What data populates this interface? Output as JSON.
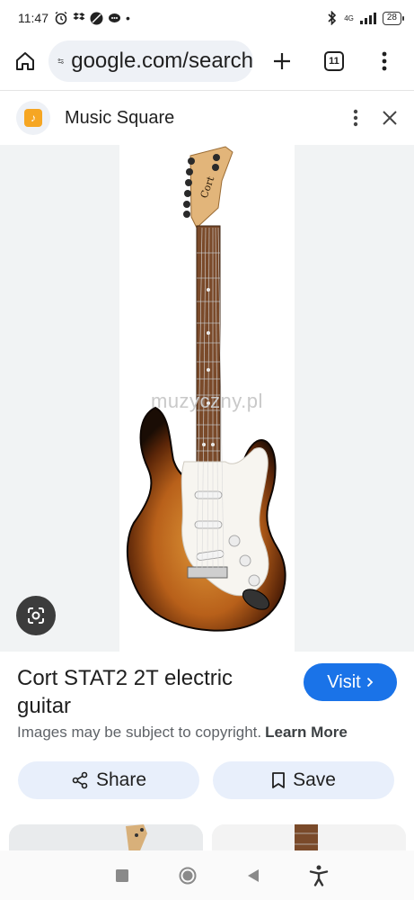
{
  "status_bar": {
    "time": "11:47",
    "battery": "28",
    "network": "4G"
  },
  "browser": {
    "url": "google.com/search",
    "tab_count": "11",
    "icons": [
      "home-icon",
      "site-info-icon",
      "new-tab-icon",
      "tabs-icon",
      "menu-icon"
    ]
  },
  "sheet": {
    "site_name": "Music Square",
    "favicon_glyph": "♪",
    "favicon_color": "#f6a623",
    "watermark": "muzyczny.pl",
    "title": "Cort STAT2 2T electric guitar",
    "visit_label": "Visit",
    "copyright_text": "Images may be subject to copyright.",
    "learn_more": "Learn More",
    "share_label": "Share",
    "save_label": "Save",
    "accent": "#1a73e8"
  },
  "guitar": {
    "brand_text": "Cort",
    "body_colors": [
      "#1a0d05",
      "#7a3a0c",
      "#d7892a"
    ]
  },
  "nav": {
    "items": [
      "recents-icon",
      "home-circle-icon",
      "back-icon",
      "accessibility-icon"
    ]
  }
}
